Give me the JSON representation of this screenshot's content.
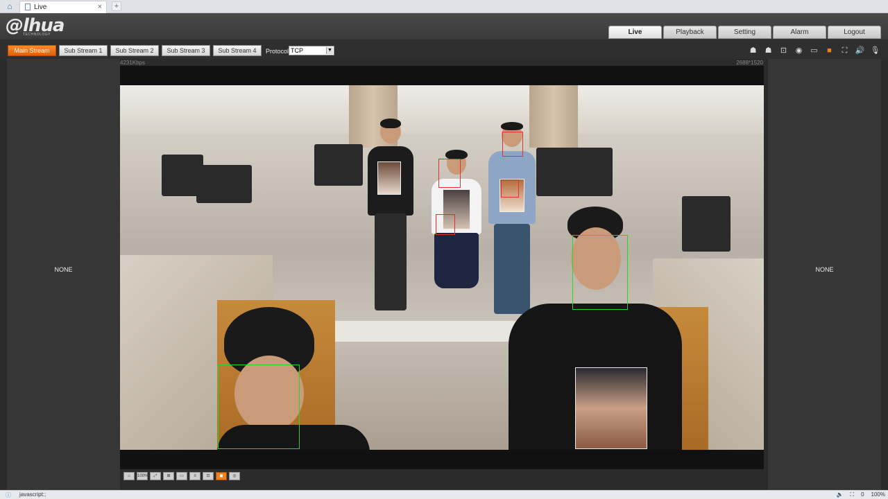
{
  "browser": {
    "tab_title": "Live",
    "close_glyph": "×",
    "newtab_glyph": "+"
  },
  "header": {
    "logo_text": "@lhua",
    "logo_sub": "TECHNOLOGY",
    "nav": [
      "Live",
      "Playback",
      "Setting",
      "Alarm",
      "Logout"
    ],
    "active_nav": "Live"
  },
  "toolbar": {
    "streams": [
      "Main Stream",
      "Sub Stream 1",
      "Sub Stream 2",
      "Sub Stream 3",
      "Sub Stream 4"
    ],
    "active_stream": "Main Stream",
    "protocol_label": "Protocol",
    "protocol_value": "TCP",
    "icons": [
      "person-icon",
      "person-icon",
      "zoom-icon",
      "snapshot-icon",
      "triple-snap-icon",
      "record-icon",
      "fullscreen-icon",
      "audio-icon",
      "microphone-icon"
    ]
  },
  "video": {
    "bitrate": "4231Kbps",
    "resolution": "2688*1520"
  },
  "side_panes": {
    "left_label": "NONE",
    "right_label": "NONE"
  },
  "video_controls": [
    "home-icon",
    "100%",
    "fit-icon",
    "zoom-icon",
    "ratio-icon",
    "fluency-icon",
    "rule-icon",
    "ivs-icon",
    "tour-icon"
  ],
  "statusbar": {
    "text": "javascript:;",
    "counter": "0",
    "zoom": "100%"
  },
  "colors": {
    "accent": "#f08020",
    "face_box_green": "#2bd42b",
    "face_box_red": "#e03030"
  }
}
